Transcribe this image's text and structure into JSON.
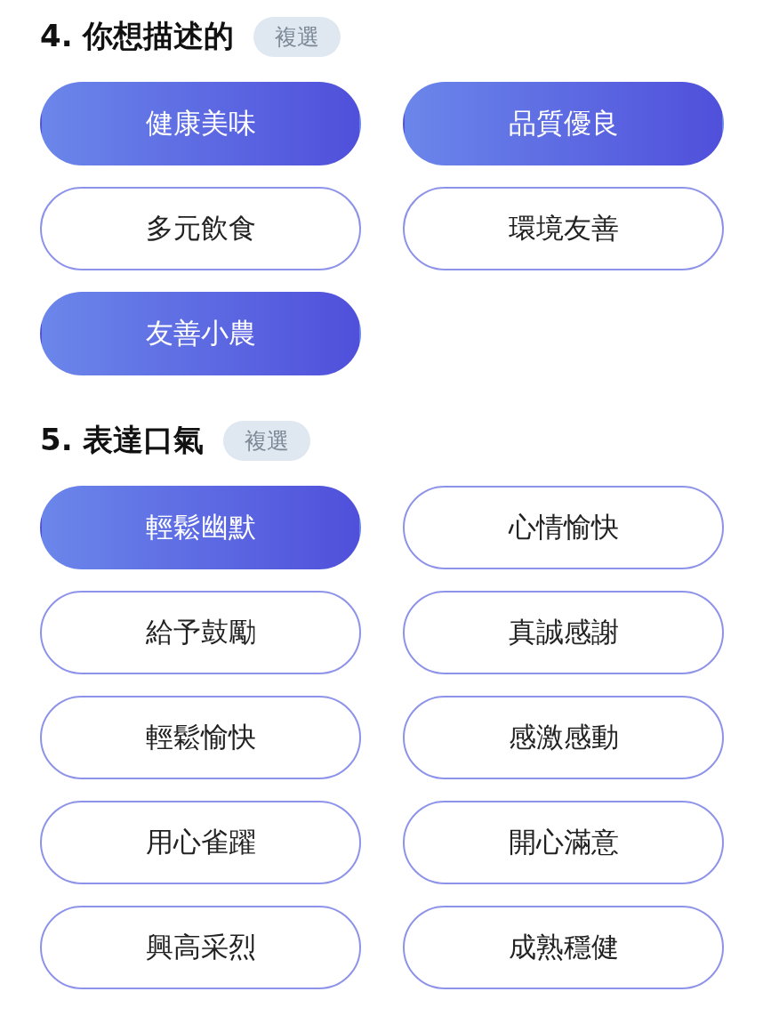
{
  "sections": [
    {
      "title": "4. 你想描述的",
      "badge": "複選",
      "options": [
        {
          "label": "健康美味",
          "selected": true
        },
        {
          "label": "品質優良",
          "selected": true
        },
        {
          "label": "多元飲食",
          "selected": false
        },
        {
          "label": "環境友善",
          "selected": false
        },
        {
          "label": "友善小農",
          "selected": true
        }
      ]
    },
    {
      "title": "5. 表達口氣",
      "badge": "複選",
      "options": [
        {
          "label": "輕鬆幽默",
          "selected": true
        },
        {
          "label": "心情愉快",
          "selected": false
        },
        {
          "label": "給予鼓勵",
          "selected": false
        },
        {
          "label": "真誠感謝",
          "selected": false
        },
        {
          "label": "輕鬆愉快",
          "selected": false
        },
        {
          "label": "感激感動",
          "selected": false
        },
        {
          "label": "用心雀躍",
          "selected": false
        },
        {
          "label": "開心滿意",
          "selected": false
        },
        {
          "label": "興高采烈",
          "selected": false
        },
        {
          "label": "成熟穩健",
          "selected": false
        }
      ]
    }
  ]
}
